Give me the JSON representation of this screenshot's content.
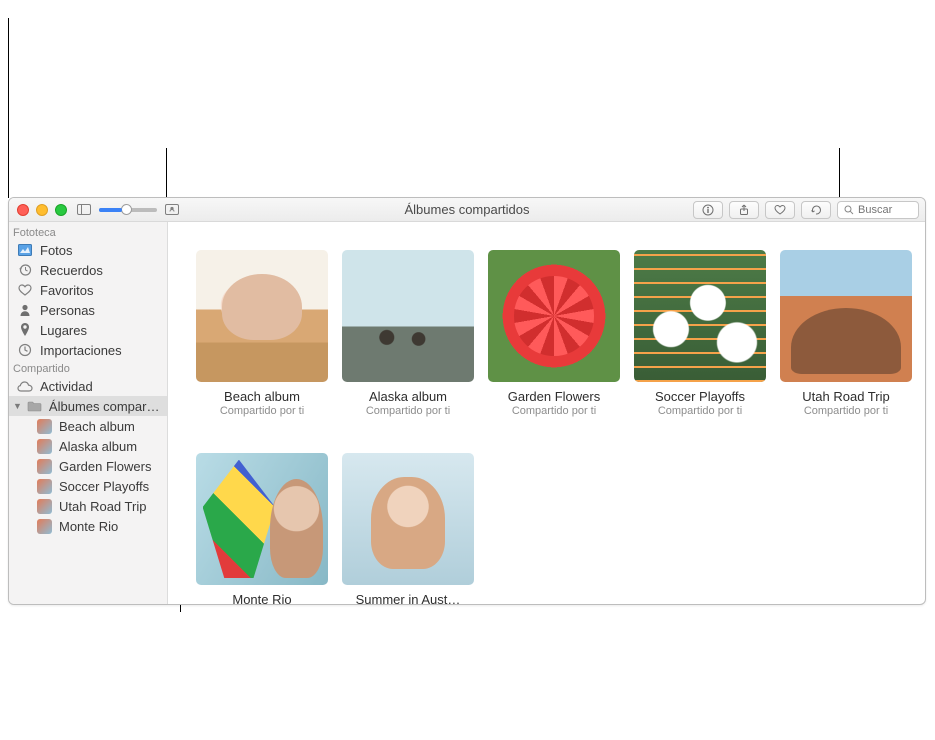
{
  "window": {
    "title": "Álbumes compartidos",
    "search_placeholder": "Buscar"
  },
  "sidebar": {
    "sections": {
      "library": {
        "header": "Fototeca",
        "items": [
          {
            "label": "Fotos"
          },
          {
            "label": "Recuerdos"
          },
          {
            "label": "Favoritos"
          },
          {
            "label": "Personas"
          },
          {
            "label": "Lugares"
          },
          {
            "label": "Importaciones"
          }
        ]
      },
      "shared": {
        "header": "Compartido",
        "activity": "Actividad",
        "shared_albums_label": "Álbumes compartid…",
        "albums": [
          {
            "label": "Beach album"
          },
          {
            "label": "Alaska album"
          },
          {
            "label": "Garden Flowers"
          },
          {
            "label": "Soccer Playoffs"
          },
          {
            "label": "Utah Road Trip"
          },
          {
            "label": "Monte Rio"
          }
        ]
      }
    }
  },
  "main": {
    "shared_by_you": "Compartido por ti",
    "albums": [
      {
        "title": "Beach album",
        "thumb": "thumb-beach"
      },
      {
        "title": "Alaska album",
        "thumb": "thumb-alaska"
      },
      {
        "title": "Garden Flowers",
        "thumb": "thumb-garden"
      },
      {
        "title": "Soccer Playoffs",
        "thumb": "thumb-soccer"
      },
      {
        "title": "Utah Road Trip",
        "thumb": "thumb-utah"
      },
      {
        "title": "Monte Rio",
        "thumb": "thumb-monte"
      },
      {
        "title": "Summer in Aust…",
        "thumb": "thumb-summer"
      }
    ]
  }
}
